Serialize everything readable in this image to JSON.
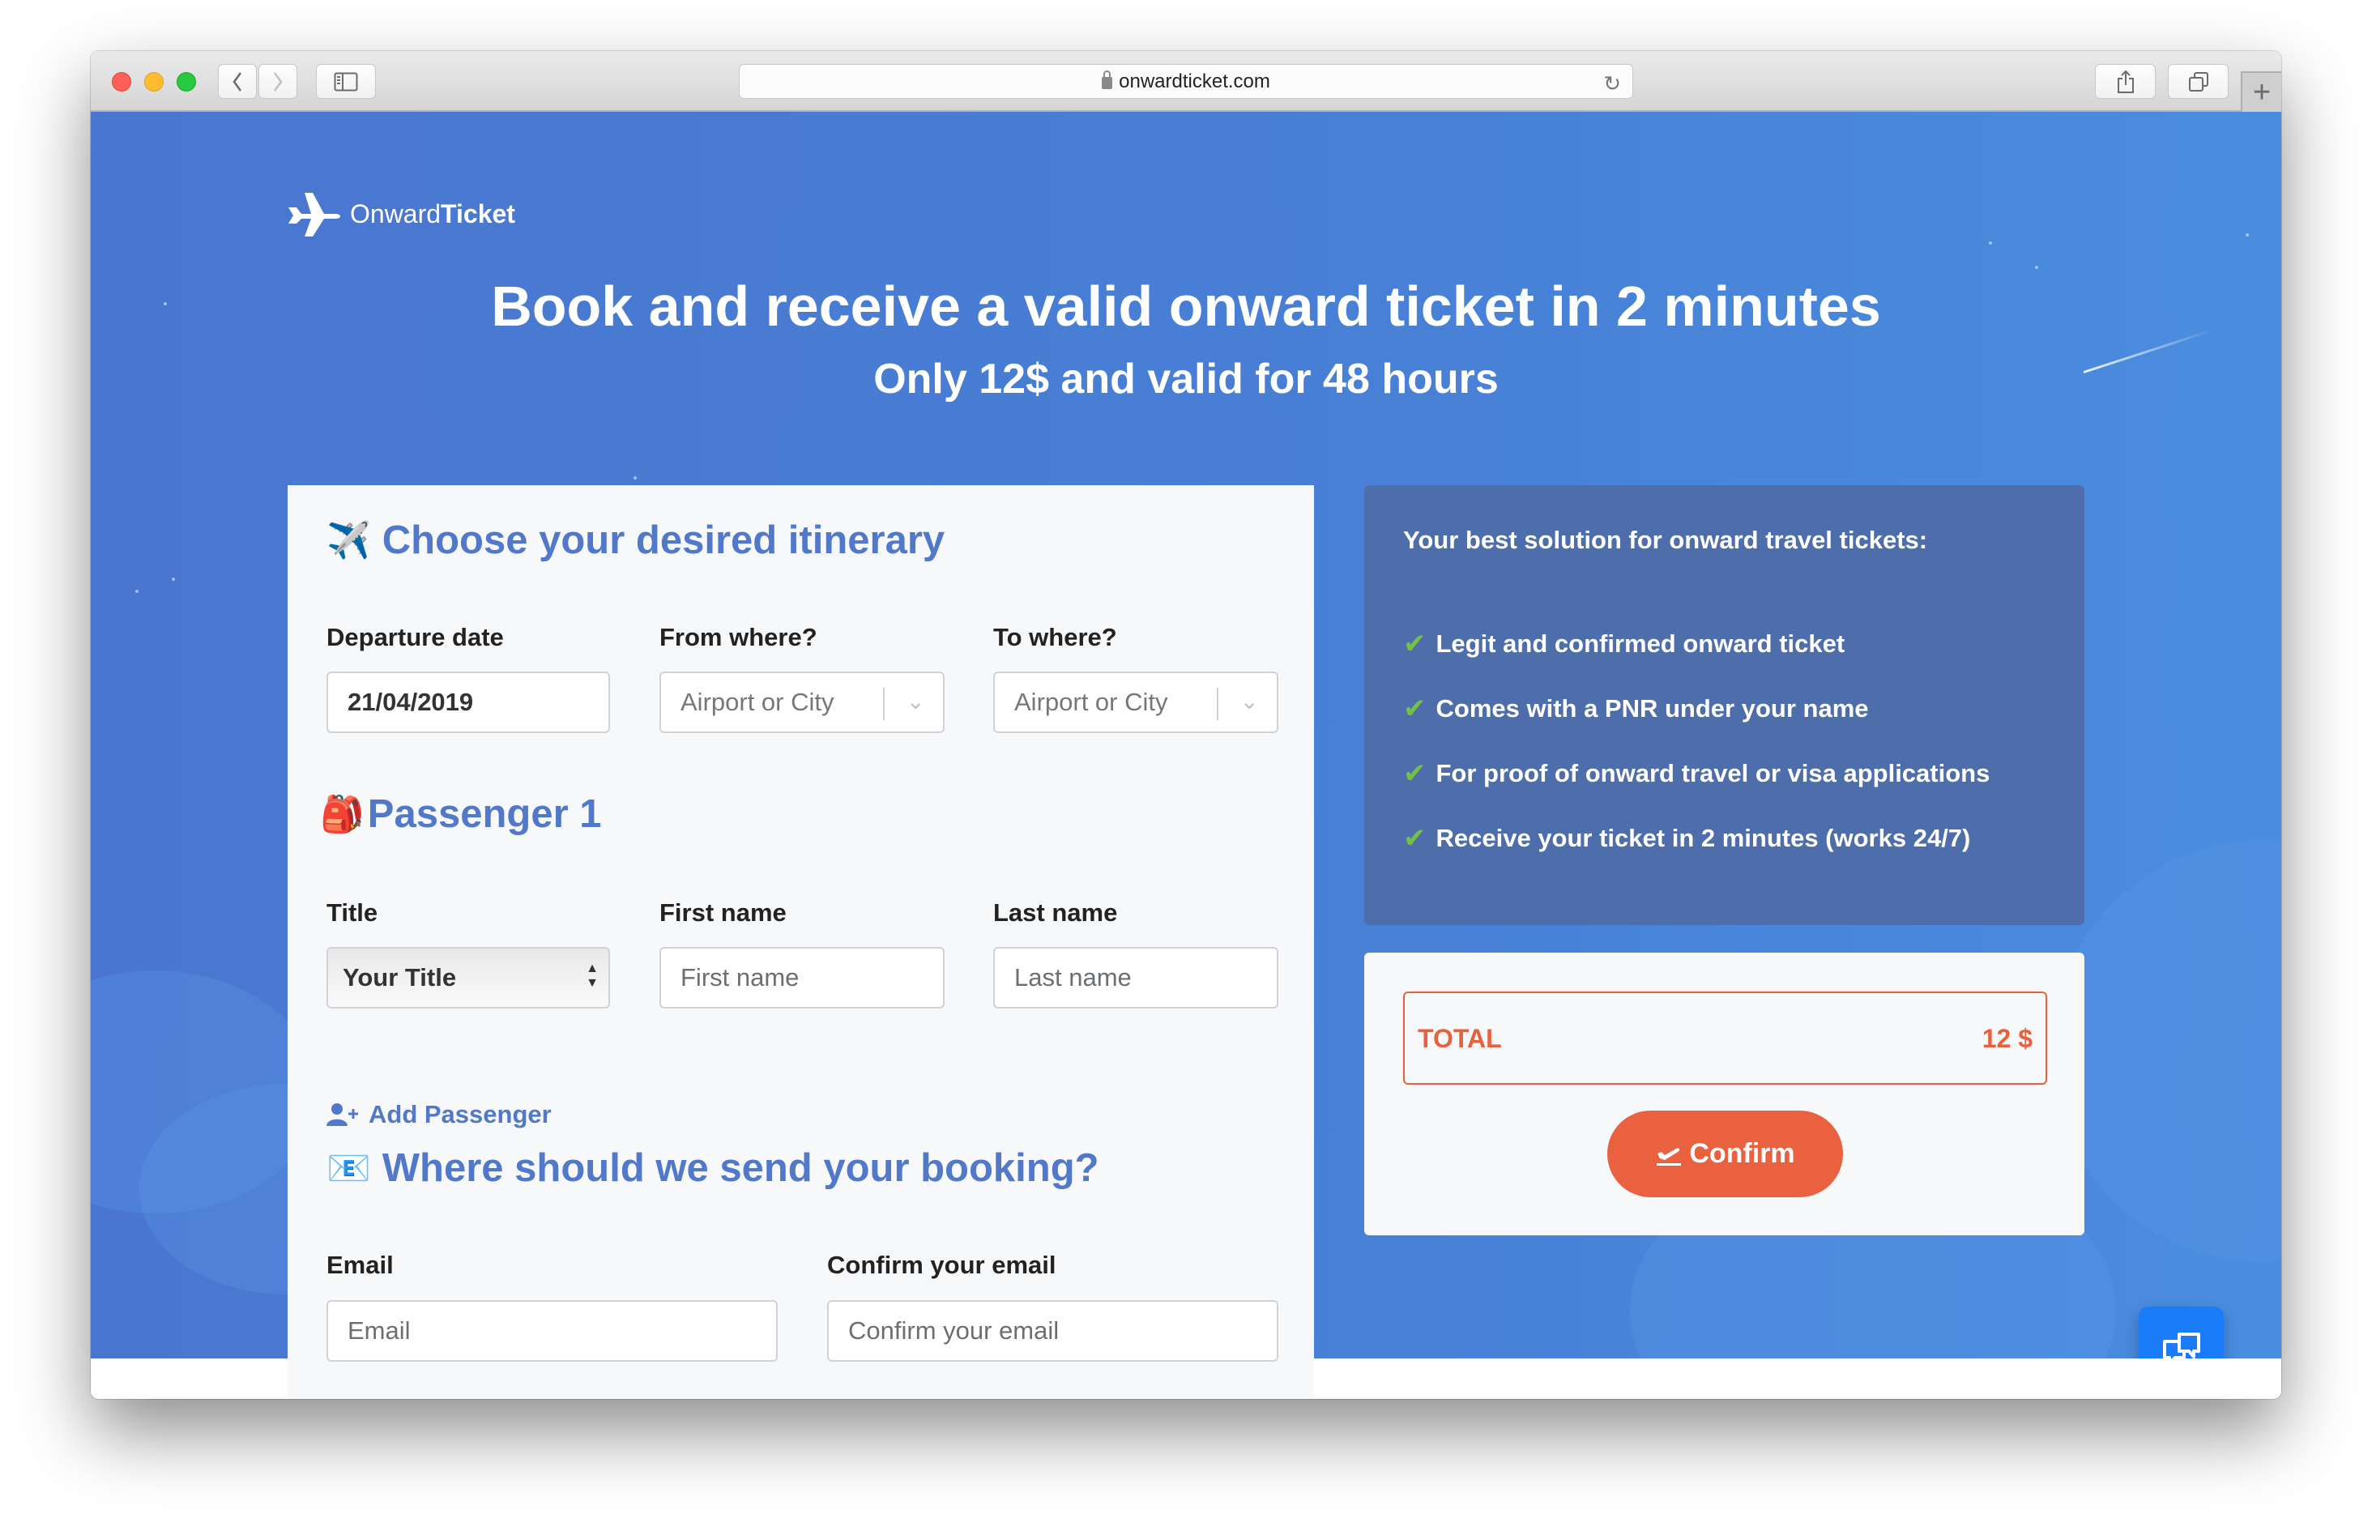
{
  "browser": {
    "url": "onwardticket.com"
  },
  "logo": {
    "light": "Onward",
    "bold": "Ticket"
  },
  "hero": {
    "headline_main": "Book and receive a valid onward ticket in ",
    "headline_bold": "2 minutes",
    "subheadline": "Only 12$ and valid for 48 hours"
  },
  "itinerary": {
    "title": "Choose your desired itinerary",
    "emoji": "✈️",
    "departure_label": "Departure date",
    "departure_value": "21/04/2019",
    "from_label": "From where?",
    "from_placeholder": "Airport or City",
    "to_label": "To where?",
    "to_placeholder": "Airport or City"
  },
  "passenger": {
    "title": "Passenger 1",
    "emoji": "🎒",
    "title_label": "Title",
    "title_selected": "Your Title",
    "first_name_label": "First name",
    "first_name_placeholder": "First name",
    "last_name_label": "Last name",
    "last_name_placeholder": "Last name",
    "add_passenger": "Add Passenger"
  },
  "booking": {
    "title": "Where should we send your booking?",
    "emoji": "📧",
    "email_label": "Email",
    "email_placeholder": "Email",
    "confirm_email_label": "Confirm your email",
    "confirm_email_placeholder": "Confirm your email"
  },
  "side_panel": {
    "heading": "Your best solution for onward travel tickets:",
    "benefits": [
      "Legit and confirmed onward ticket",
      "Comes with a PNR under your name",
      "For proof of onward travel or visa applications",
      "Receive your ticket in 2 minutes (works 24/7)"
    ]
  },
  "checkout": {
    "total_label": "TOTAL",
    "total_value": "12 $",
    "confirm_label": "Confirm"
  },
  "colors": {
    "brand_blue": "#4a76cf",
    "heading_blue": "#5279c9",
    "accent_orange": "#ea6140",
    "check_green": "#74c043",
    "chat_blue": "#1a7cf8"
  }
}
